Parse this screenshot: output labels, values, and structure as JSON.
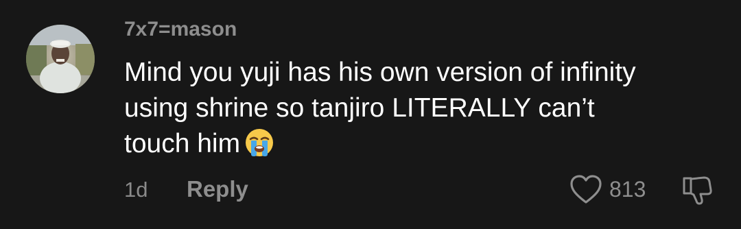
{
  "comment": {
    "username": "7x7=mason",
    "text_lines": [
      "Mind you yuji has his own version of infinity",
      "using shrine so tanjiro LITERALLY can’t",
      "touch him"
    ],
    "emoji": "loudly-crying-face",
    "time": "1d",
    "reply_label": "Reply",
    "like_count": "813"
  },
  "icons": {
    "like": "heart-icon",
    "dislike": "thumbs-down-icon"
  },
  "colors": {
    "background": "#171717",
    "text": "#ffffff",
    "muted": "#8e8e8e"
  }
}
